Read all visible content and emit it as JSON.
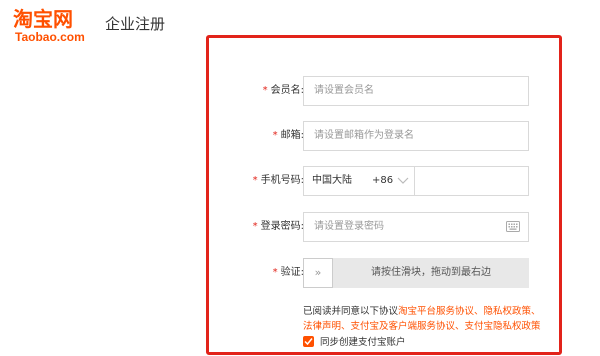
{
  "logo": {
    "cn": "淘宝网",
    "en": "Taobao.com"
  },
  "page_title": "企业注册",
  "form": {
    "member_name": {
      "label": "会员名:",
      "placeholder": "请设置会员名"
    },
    "email": {
      "label": "邮箱:",
      "placeholder": "请设置邮箱作为登录名"
    },
    "phone": {
      "label": "手机号码:",
      "region": "中国大陆",
      "code": "+86"
    },
    "password": {
      "label": "登录密码:",
      "placeholder": "请设置登录密码"
    },
    "verify": {
      "label": "验证:",
      "handle": "»",
      "text": "请按住滑块，拖动到最右边"
    },
    "agreement": {
      "prefix": "已阅读并同意以下协议",
      "links": [
        "淘宝平台服务协议",
        "、隐私权政策",
        "、",
        "法律声明",
        "、支付宝及客户端服务协议",
        "、支付宝隐私权政策"
      ]
    },
    "sync": {
      "label": "同步创建支付宝账户",
      "checked": true
    }
  },
  "colors": {
    "brand": "#ff5000",
    "border": "#e2231a",
    "required": "#e2231a"
  }
}
